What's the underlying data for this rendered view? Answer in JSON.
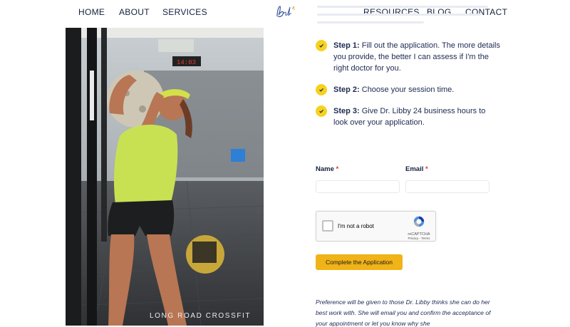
{
  "nav": {
    "left": [
      "HOME",
      "ABOUT",
      "SERVICES"
    ],
    "right": [
      "RESOURCES",
      "BLOG",
      "CONTACT"
    ]
  },
  "photo": {
    "caption": "LONG ROAD CROSSFIT"
  },
  "steps": [
    {
      "label": "Step 1:",
      "text": " Fill out the application. The more details you provide, the better I can assess if I'm the right doctor for you."
    },
    {
      "label": "Step 2:",
      "text": " Choose your session time."
    },
    {
      "label": "Step 3:",
      "text": " Give Dr. Libby 24 business hours to look over your application."
    }
  ],
  "form": {
    "name_label": "Name",
    "email_label": "Email",
    "required_marker": "*",
    "name_value": "",
    "email_value": "",
    "recaptcha": {
      "label": "I'm not a robot",
      "brand": "reCAPTCHA",
      "links": "Privacy - Terms"
    },
    "submit_label": "Complete the Application"
  },
  "note": "Preference will be given to those Dr. Libby thinks she can do her best work with. She will email you and confirm the acceptance of your appointment or let you know why she",
  "colors": {
    "accent_yellow": "#f6d220",
    "button_orange": "#f0b318",
    "text_navy": "#1d2a52",
    "required_red": "#d33a2c"
  }
}
